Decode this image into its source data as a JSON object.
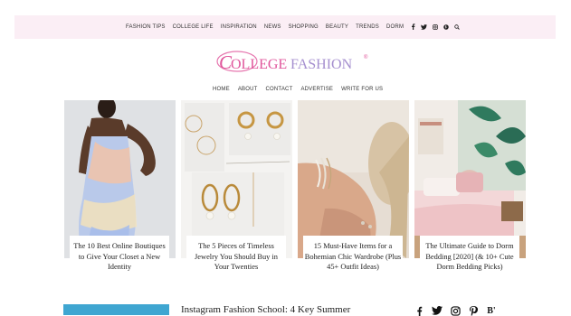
{
  "top_nav": {
    "items": [
      "FASHION TIPS",
      "COLLEGE LIFE",
      "INSPIRATION",
      "NEWS",
      "SHOPPING",
      "BEAUTY",
      "TRENDS",
      "DORM"
    ],
    "social_icons": [
      "facebook-icon",
      "twitter-icon",
      "instagram-icon",
      "pinterest-icon",
      "search-icon"
    ]
  },
  "logo": {
    "text": "CollegeFashion",
    "registered": "®",
    "colors": {
      "pink": "#e0559b",
      "lavender": "#a58fcf"
    }
  },
  "sub_nav": {
    "items": [
      "HOME",
      "ABOUT",
      "CONTACT",
      "ADVERTISE",
      "WRITE FOR US"
    ]
  },
  "cards": [
    {
      "title": "The 10 Best Online Boutiques to Give Your Closet a New Identity"
    },
    {
      "title": "The 5 Pieces of Timeless Jewelry You Should Buy in Your Twenties"
    },
    {
      "title": "15 Must-Have Items for a Bohemian Chic Wardrobe (Plus 45+ Outfit Ideas)"
    },
    {
      "title": "The Ultimate Guide to Dorm Bedding [2020] (& 10+ Cute Dorm Bedding Picks)"
    }
  ],
  "featured": {
    "title": "Instagram Fashion School: 4 Key Summer"
  },
  "bottom_social": [
    "facebook-icon",
    "twitter-icon",
    "instagram-icon",
    "pinterest-icon",
    "bloglovin-icon"
  ],
  "bloglovin_label": "B'"
}
